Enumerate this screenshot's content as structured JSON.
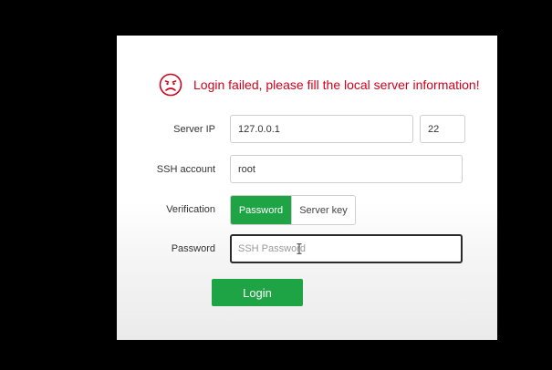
{
  "error": {
    "icon": "sad-face-icon",
    "message": "Login failed, please fill the local server information!",
    "color": "#d0021b"
  },
  "form": {
    "server_ip_label": "Server IP",
    "server_ip_value": "127.0.0.1",
    "port_value": "22",
    "ssh_account_label": "SSH account",
    "ssh_account_value": "root",
    "verification_label": "Verification",
    "verification_options": [
      "Password",
      "Server key"
    ],
    "verification_selected": "Password",
    "password_label": "Password",
    "password_placeholder": "SSH Password",
    "password_value": ""
  },
  "login_button_label": "Login",
  "colors": {
    "accent": "#1ea345",
    "background": "#000000",
    "panel": "#ffffff"
  }
}
